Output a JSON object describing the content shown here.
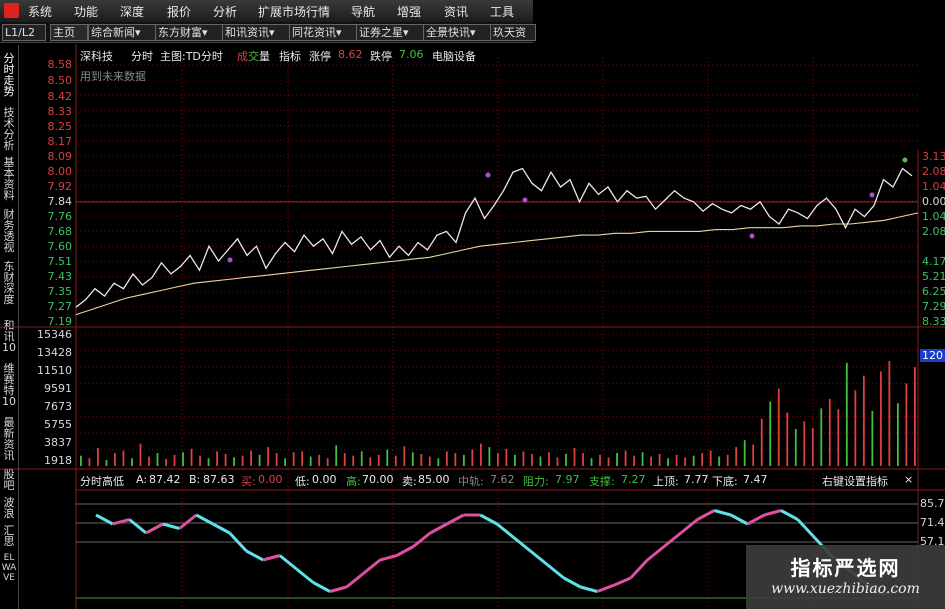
{
  "menu": {
    "items": [
      "系统",
      "功能",
      "深度",
      "报价",
      "分析",
      "扩展市场行情",
      "导航",
      "增强",
      "资讯",
      "工具"
    ],
    "colors": {
      "bg": "#2a2a2a",
      "text": "#e8e8e8",
      "logo": "#d22222"
    }
  },
  "tabs": {
    "pager": "L1/L2",
    "home": "主页",
    "items": [
      "综合新闻▾",
      "东方财富▾",
      "和讯资讯▾",
      "同花资讯▾",
      "证券之星▾",
      "全景快讯▾",
      "玖天资"
    ]
  },
  "sidebar": {
    "tabs": [
      "分时走势",
      "技术分析",
      "基本资料",
      "财务透视",
      "东财深度",
      "和讯10",
      "维赛特10",
      "最新资讯",
      "股吧",
      "波浪",
      "汇思",
      "ELWAVE"
    ]
  },
  "header": {
    "stock": "深科技",
    "mode": "分时",
    "main_label": "主图:TD分时",
    "vol_a": "成",
    "vol_b": "交",
    "vol_c": "量",
    "indicator": "指标",
    "limit_up_label": "涨停",
    "limit_up_value": "8.62",
    "limit_down_label": "跌停",
    "limit_down_value": "7.06",
    "sector": "电脑设备",
    "note": "用到未来数据"
  },
  "price_axis": {
    "left": [
      "8.58",
      "8.50",
      "8.42",
      "8.33",
      "8.25",
      "8.17",
      "8.09",
      "8.00",
      "7.92",
      "7.84",
      "7.76",
      "7.68",
      "7.60",
      "7.51",
      "7.43",
      "7.35",
      "7.27",
      "7.19"
    ],
    "right": [
      "3.13",
      "2.08",
      "1.04",
      "0.00",
      "1.04",
      "2.08",
      "4.17",
      "5.21",
      "6.25",
      "7.29",
      "8.33"
    ]
  },
  "volume_axis": {
    "left": [
      "15346",
      "13428",
      "11510",
      "9591",
      "7673",
      "5755",
      "3837",
      "1918"
    ],
    "right_current": "120"
  },
  "indicator_panel": {
    "name": "分时高低",
    "a_label": "A:",
    "a_value": "87.42",
    "b_label": "B:",
    "b_value": "87.63",
    "buy_label": "买:",
    "buy_value": "0.00",
    "low_label": "低:",
    "low_value": "0.00",
    "high_label": "高:",
    "high_value": "70.00",
    "sell_label": "卖:",
    "sell_value": "85.00",
    "mid_label": "中轨:",
    "mid_value": "7.62",
    "res_label": "阻力:",
    "res_value": "7.97",
    "sup_label": "支撑:",
    "sup_value": "7.27",
    "top_label": "上顶:",
    "top_value": "7.77",
    "bottom_label": "下底:",
    "bottom_value": "7.47",
    "settings": "右键设置指标",
    "close": "×",
    "right_axis": [
      "85.7",
      "71.4",
      "57.1"
    ]
  },
  "chart_data": {
    "type": "line",
    "price_line": [
      7.27,
      7.31,
      7.37,
      7.33,
      7.4,
      7.37,
      7.45,
      7.39,
      7.43,
      7.51,
      7.45,
      7.49,
      7.55,
      7.47,
      7.6,
      7.52,
      7.58,
      7.64,
      7.55,
      7.6,
      7.48,
      7.56,
      7.62,
      7.57,
      7.66,
      7.6,
      7.64,
      7.56,
      7.68,
      7.61,
      7.65,
      7.58,
      7.63,
      7.54,
      7.6,
      7.55,
      7.62,
      7.58,
      7.66,
      7.68,
      7.62,
      7.78,
      7.86,
      7.75,
      7.82,
      7.9,
      8.0,
      8.02,
      7.94,
      7.9,
      8.0,
      7.92,
      7.96,
      7.84,
      7.94,
      7.88,
      7.92,
      7.84,
      7.9,
      7.86,
      7.87,
      7.8,
      7.85,
      7.9,
      7.86,
      7.84,
      7.79,
      7.83,
      7.8,
      7.78,
      7.82,
      7.8,
      7.84,
      7.76,
      7.72,
      7.8,
      7.78,
      7.75,
      7.82,
      7.86,
      7.8,
      7.7,
      7.8,
      7.76,
      7.82,
      7.96,
      7.92,
      8.02,
      7.98
    ],
    "avg_line": [
      7.23,
      7.26,
      7.29,
      7.32,
      7.34,
      7.36,
      7.38,
      7.4,
      7.41,
      7.42,
      7.43,
      7.44,
      7.45,
      7.46,
      7.47,
      7.48,
      7.49,
      7.5,
      7.51,
      7.52,
      7.53,
      7.54,
      7.56,
      7.58,
      7.6,
      7.61,
      7.62,
      7.63,
      7.64,
      7.65,
      7.66,
      7.66,
      7.67,
      7.67,
      7.68,
      7.68,
      7.68,
      7.68,
      7.69,
      7.69,
      7.7,
      7.7,
      7.7,
      7.71,
      7.71,
      7.72,
      7.72,
      7.73,
      7.74,
      7.76,
      7.78
    ],
    "volume": [
      1200,
      900,
      2100,
      700,
      1500,
      1800,
      900,
      2600,
      1100,
      1500,
      800,
      1300,
      1600,
      2000,
      1200,
      900,
      1700,
      1400,
      1000,
      1200,
      1800,
      1300,
      2200,
      1500,
      900,
      1600,
      1700,
      1100,
      1300,
      900,
      2400,
      1500,
      1200,
      1700,
      1000,
      1300,
      1900,
      1200,
      2300,
      1600,
      1400,
      1100,
      900,
      1700,
      1500,
      1300,
      1900,
      2600,
      2200,
      1500,
      2000,
      1300,
      1700,
      1400,
      1100,
      1600,
      1000,
      1400,
      2100,
      1500,
      900,
      1300,
      1000,
      1500,
      1800,
      1200,
      1600,
      1100,
      1400,
      900,
      1300,
      1000,
      1200,
      1500,
      1800,
      1100,
      1300,
      2200,
      3000,
      2500,
      5500,
      7500,
      9000,
      6200,
      4300,
      5200,
      4400,
      6700,
      7800,
      6600,
      12000,
      8800,
      10500,
      6400,
      11000,
      12200,
      7300,
      9600,
      11500
    ],
    "ylim": [
      7.19,
      8.58
    ],
    "vol_ylim": [
      0,
      15346
    ]
  },
  "watermark": {
    "line1": "指标严选网",
    "line2": "www.xuezhibiao.com"
  }
}
